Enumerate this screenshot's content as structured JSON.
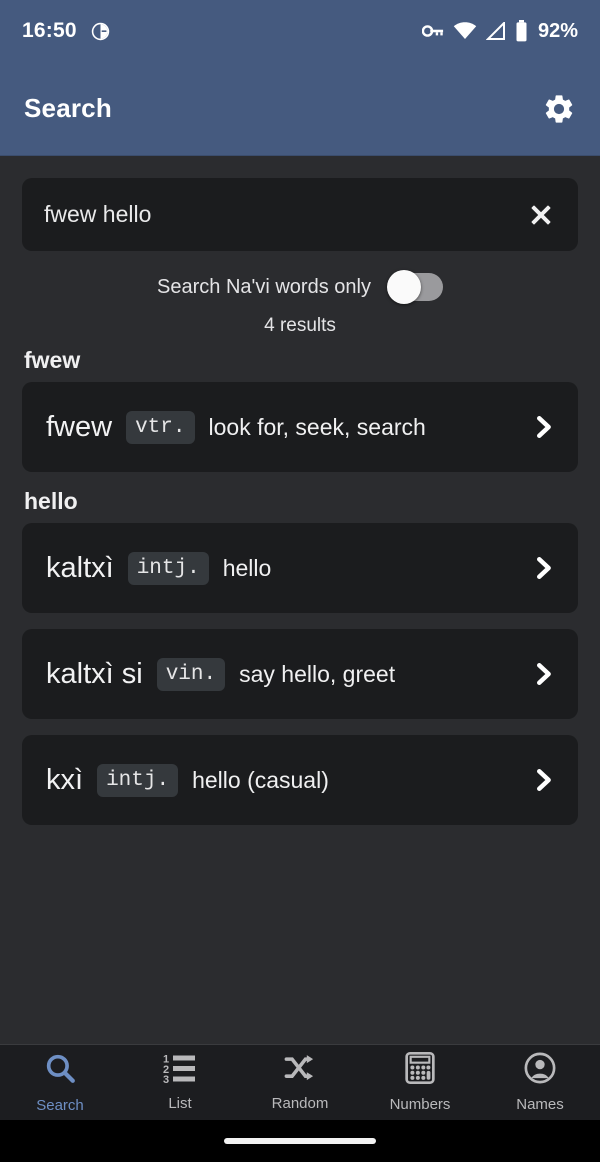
{
  "status_bar": {
    "time": "16:50",
    "icons": [
      "do-not-disturb-icon",
      "vpn-key-icon",
      "wifi-icon",
      "cell-signal-icon",
      "battery-icon"
    ],
    "battery_percent": "92%"
  },
  "app_bar": {
    "title": "Search",
    "settings_icon": "gear-icon"
  },
  "search": {
    "value": "fwew hello",
    "placeholder": "Search",
    "clear_icon": "close-icon",
    "navi_only_label": "Search Na'vi words only",
    "navi_only_on": false,
    "results_count_label": "4 results"
  },
  "sections": [
    {
      "header": "fwew",
      "entries": [
        {
          "word": "fwew",
          "pos": "vtr.",
          "definition": "look for, seek, search",
          "chevron": "chevron-right-icon"
        }
      ]
    },
    {
      "header": "hello",
      "entries": [
        {
          "word": "kaltxì",
          "pos": "intj.",
          "definition": "hello",
          "chevron": "chevron-right-icon"
        },
        {
          "word": "kaltxì si",
          "pos": "vin.",
          "definition": "say hello, greet",
          "chevron": "chevron-right-icon"
        },
        {
          "word": "kxì",
          "pos": "intj.",
          "definition": "hello (casual)",
          "chevron": "chevron-right-icon"
        }
      ]
    }
  ],
  "bottom_nav": {
    "active_index": 0,
    "items": [
      {
        "label": "Search",
        "icon": "search-icon"
      },
      {
        "label": "List",
        "icon": "numbered-list-icon"
      },
      {
        "label": "Random",
        "icon": "shuffle-icon"
      },
      {
        "label": "Numbers",
        "icon": "calculator-icon"
      },
      {
        "label": "Names",
        "icon": "person-circle-icon"
      }
    ]
  },
  "colors": {
    "header_blue": "#455a7f",
    "page_background": "#2b2c2f",
    "card_background": "#1b1c1e",
    "badge_background": "#35393d",
    "nav_active": "#6e8fc4",
    "nav_inactive": "#b9b9bb"
  }
}
